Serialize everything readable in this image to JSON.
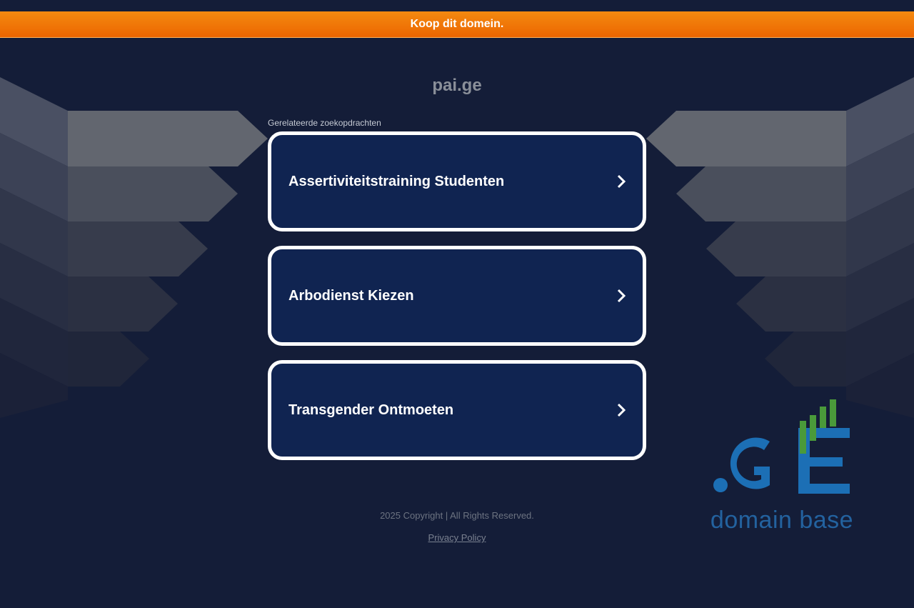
{
  "banner": {
    "text": "Koop dit domein."
  },
  "domain": {
    "name": "pai.ge"
  },
  "related": {
    "label": "Gerelateerde zoekopdrachten",
    "items": [
      {
        "label": "Assertiviteitstraining Studenten"
      },
      {
        "label": "Arbodienst Kiezen"
      },
      {
        "label": "Transgender Ontmoeten"
      }
    ]
  },
  "footer": {
    "copyright": "2025 Copyright | All Rights Reserved.",
    "privacy": "Privacy Policy"
  },
  "logo": {
    "mark": ".GE",
    "text": "domain base"
  },
  "colors": {
    "background": "#141d38",
    "banner": "#f07a00",
    "card": "#102451",
    "card_border": "#ffffff",
    "logo_blue": "#1c6fb5",
    "logo_green": "#4a9a3a"
  },
  "icons": {
    "card_arrow": "chevron-right-icon"
  }
}
